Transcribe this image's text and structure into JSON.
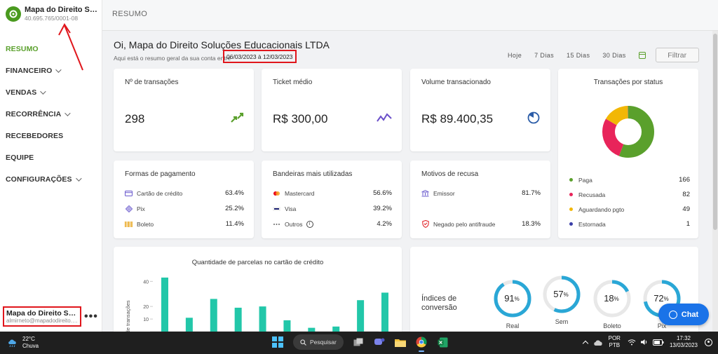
{
  "sidebar": {
    "brand_name": "Mapa do Direito Soluções Educacionais LTDA",
    "brand_sub": "40.695.765/0001-08",
    "nav": [
      {
        "label": "RESUMO",
        "chevron": false,
        "active": true
      },
      {
        "label": "FINANCEIRO",
        "chevron": true
      },
      {
        "label": "VENDAS",
        "chevron": true
      },
      {
        "label": "RECORRÊNCIA",
        "chevron": true
      },
      {
        "label": "RECEBEDORES",
        "chevron": false
      },
      {
        "label": "EQUIPE",
        "chevron": false
      },
      {
        "label": "CONFIGURAÇÕES",
        "chevron": true
      }
    ],
    "user_name": "Mapa do Direito Soluções Educacionais LTDA",
    "user_email": "almirneto@mapadodireito.com.br",
    "more": "•••"
  },
  "header": {
    "title": "RESUMO"
  },
  "main": {
    "greeting": "Oi, Mapa do Direito Soluções Educacionais LTDA",
    "subline": "Aqui está o resumo geral da sua conta entre",
    "daterange": "06/03/2023 à 12/03/2023",
    "filters": [
      "Hoje",
      "7 Dias",
      "15 Dias",
      "30 Dias"
    ],
    "filter_button": "Filtrar"
  },
  "kpis": [
    {
      "title": "Nº de transações",
      "value": "298",
      "icon": "arrows-icon"
    },
    {
      "title": "Ticket médio",
      "value": "R$ 300,00",
      "icon": "trend-icon"
    },
    {
      "title": "Volume transacionado",
      "value": "R$ 89.400,35",
      "icon": "pie-icon"
    }
  ],
  "payment_methods": {
    "title": "Formas de pagamento",
    "rows": [
      {
        "label": "Cartão de crédito",
        "value": "63.4%",
        "icon": "card-icon"
      },
      {
        "label": "Pix",
        "value": "25.2%",
        "icon": "pix-icon"
      },
      {
        "label": "Boleto",
        "value": "11.4%",
        "icon": "barcode-icon"
      }
    ]
  },
  "brands": {
    "title": "Bandeiras mais utilizadas",
    "rows": [
      {
        "label": "Mastercard",
        "value": "56.6%",
        "icon": "mastercard-icon"
      },
      {
        "label": "Visa",
        "value": "39.2%",
        "icon": "visa-icon"
      },
      {
        "label": "Outros",
        "value": "4.2%",
        "icon": "dots-icon"
      }
    ]
  },
  "refusals": {
    "title": "Motivos de recusa",
    "rows": [
      {
        "label": "Emissor",
        "value": "81.7%",
        "icon": "bank-icon"
      },
      {
        "label": "Negado pelo antifraude",
        "value": "18.3%",
        "icon": "shield-icon"
      }
    ]
  },
  "status": {
    "title": "Transações por status",
    "colors": {
      "paga": "#5aa02c",
      "recusada": "#e8245a",
      "aguardando": "#f2b705",
      "estornada": "#3b3fa8"
    },
    "items": [
      {
        "label": "Paga",
        "value": "166",
        "color": "#5aa02c"
      },
      {
        "label": "Recusada",
        "value": "82",
        "color": "#e8245a"
      },
      {
        "label": "Aguardando pgto",
        "value": "49",
        "color": "#f2b705"
      },
      {
        "label": "Estornada",
        "value": "1",
        "color": "#3b3fa8"
      }
    ]
  },
  "chart_data": {
    "type": "bar",
    "title": "Quantidade de parcelas no cartão de crédito",
    "ylabel": "Nº de transações",
    "yticks": [
      10,
      20,
      40
    ],
    "values": [
      43,
      11,
      26,
      19,
      20,
      9,
      3,
      4,
      25,
      31
    ],
    "color": "#22c7a9"
  },
  "conversion": {
    "title": "Índices de conversão",
    "accent": "#2aa7d6",
    "gauges": [
      {
        "pct": 91,
        "text": "91",
        "label": "Real"
      },
      {
        "pct": 57,
        "text": "57",
        "label": "Sem"
      },
      {
        "pct": 18,
        "text": "18",
        "label": "Boleto"
      },
      {
        "pct": 72,
        "text": "72",
        "label": "Pix"
      }
    ],
    "pct_sign": "%"
  },
  "chat": {
    "label": "Chat"
  },
  "taskbar": {
    "temp": "22°C",
    "weather": "Chuva",
    "search": "Pesquisar",
    "lang1": "POR",
    "lang2": "PTB",
    "time": "17:32",
    "date": "13/03/2023"
  }
}
